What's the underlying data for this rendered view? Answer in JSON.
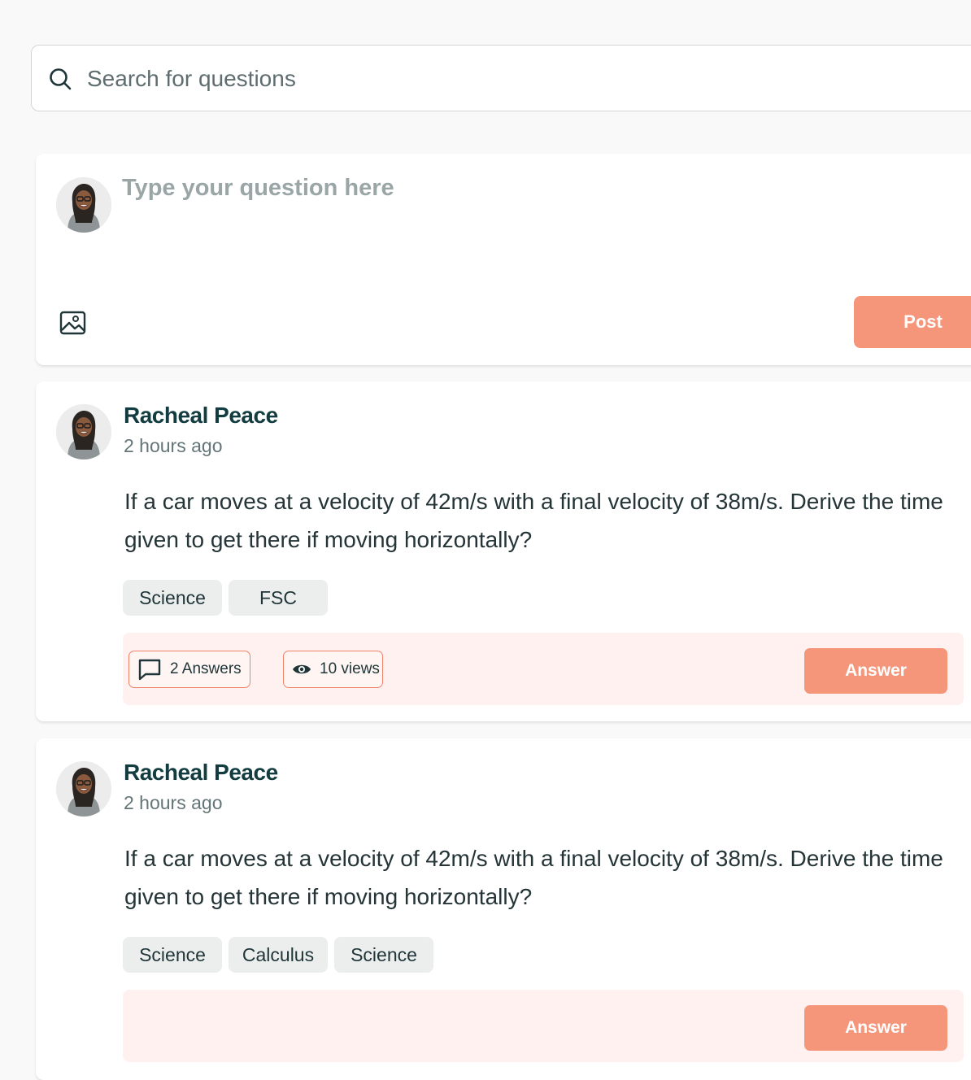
{
  "search": {
    "placeholder": "Search for questions"
  },
  "composer": {
    "placeholder": "Type your question here",
    "post_label": "Post"
  },
  "posts": [
    {
      "author": "Racheal Peace",
      "time": "2 hours ago",
      "question": "If a car moves at a velocity of 42m/s with a final velocity of 38m/s. Derive the time given to get there if moving horizontally?",
      "tags": [
        "Science",
        "FSC"
      ],
      "answers_label": "2 Answers",
      "views_label": "10 views",
      "answer_button": "Answer"
    },
    {
      "author": "Racheal Peace",
      "time": "2 hours ago",
      "question": "If a car moves at a velocity of 42m/s with a final velocity of 38m/s. Derive the time given to get there if moving horizontally?",
      "tags": [
        "Science",
        "Calculus",
        "Science"
      ],
      "answers_label": "",
      "views_label": "",
      "answer_button": "Answer"
    }
  ],
  "colors": {
    "accent": "#f5967b",
    "name": "#123c3f",
    "footer_bg": "#fff1ef"
  }
}
